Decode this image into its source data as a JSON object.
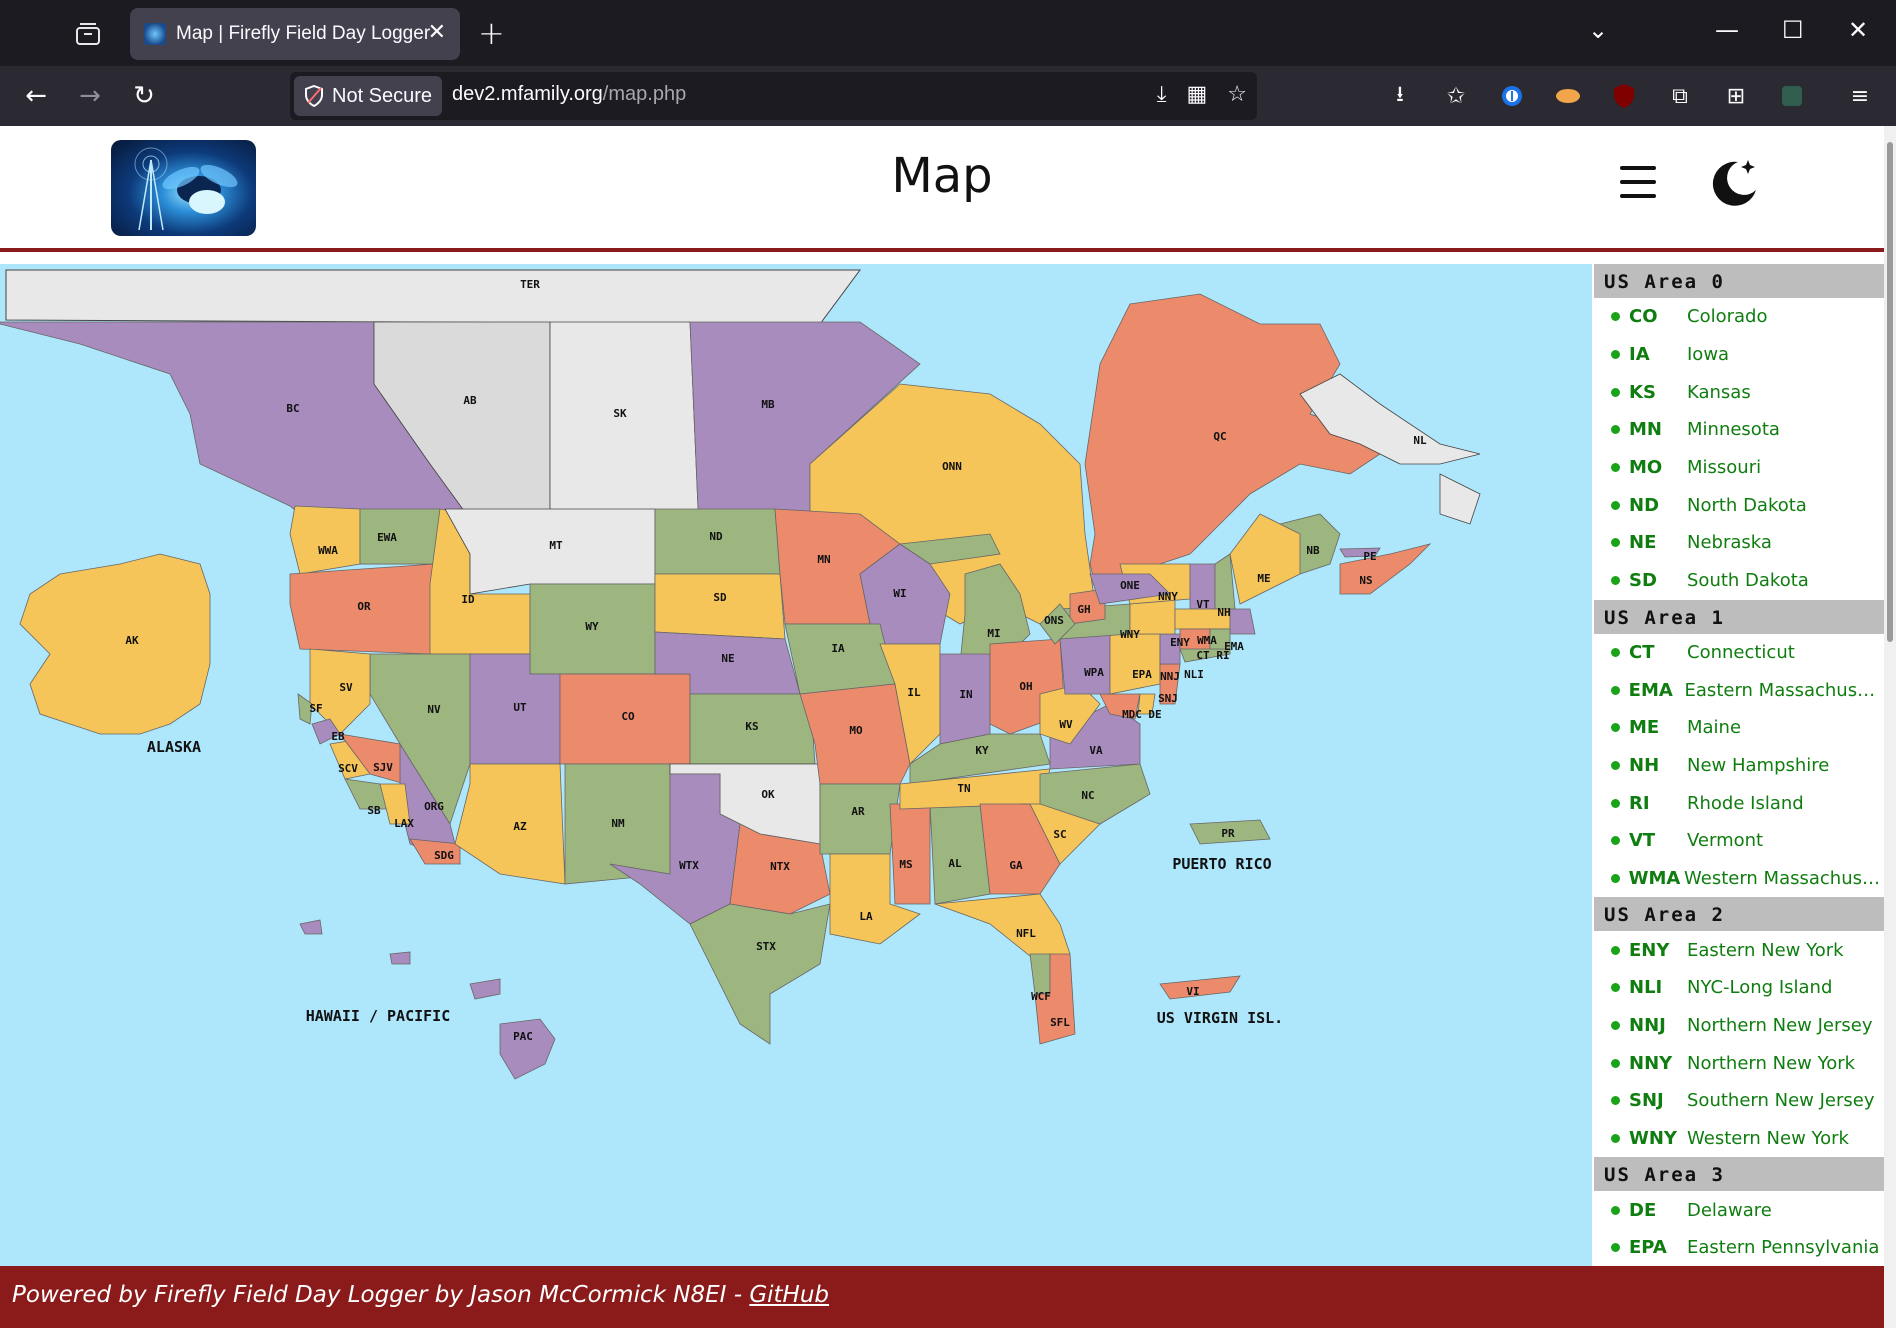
{
  "browser": {
    "tab_title": "Map | Firefly Field Day Logger",
    "security_label": "Not Secure",
    "url_domain": "dev2.mfamily.org",
    "url_path": "/map.php"
  },
  "page": {
    "title": "Map"
  },
  "map": {
    "labels": {
      "TER": "TER",
      "BC": "BC",
      "AB": "AB",
      "SK": "SK",
      "MB": "MB",
      "ONN": "ONN",
      "QC": "QC",
      "NL": "NL",
      "NB": "NB",
      "PE": "PE",
      "NS": "NS",
      "AK": "AK",
      "ALASKA": "ALASKA",
      "WWA": "WWA",
      "EWA": "EWA",
      "OR": "OR",
      "ID": "ID",
      "MT": "MT",
      "WY": "WY",
      "ND": "ND",
      "SD": "SD",
      "MN": "MN",
      "WI": "WI",
      "MI": "MI",
      "ONS": "ONS",
      "GH": "GH",
      "ONE": "ONE",
      "NNY": "NNY",
      "VT": "VT",
      "NH": "NH",
      "ME": "ME",
      "WNY": "WNY",
      "ENY": "ENY",
      "WMA": "WMA",
      "EMA": "EMA",
      "CT": "CT",
      "RI": "RI",
      "NNJ": "NNJ",
      "NLI": "NLI",
      "SNJ": "SNJ",
      "EPA": "EPA",
      "WPA": "WPA",
      "MDC": "MDC",
      "DE": "DE",
      "OH": "OH",
      "IN": "IN",
      "IL": "IL",
      "IA": "IA",
      "NE": "NE",
      "KS": "KS",
      "MO": "MO",
      "CO": "CO",
      "UT": "UT",
      "NV": "NV",
      "SV": "SV",
      "SF": "SF",
      "EB": "EB",
      "SCV": "SCV",
      "SJV": "SJV",
      "SB": "SB",
      "LAX": "LAX",
      "ORG": "ORG",
      "SDG": "SDG",
      "AZ": "AZ",
      "NM": "NM",
      "OK": "OK",
      "WTX": "WTX",
      "NTX": "NTX",
      "STX": "STX",
      "AR": "AR",
      "LA": "LA",
      "MS": "MS",
      "AL": "AL",
      "TN": "TN",
      "KY": "KY",
      "WV": "WV",
      "VA": "VA",
      "NC": "NC",
      "SC": "SC",
      "GA": "GA",
      "NFL": "NFL",
      "WCF": "WCF",
      "SFL": "SFL",
      "PR": "PR",
      "PUERTO_RICO": "PUERTO RICO",
      "VI": "VI",
      "US_VIRGIN": "US VIRGIN ISL.",
      "PAC": "PAC",
      "HAWAII": "HAWAII / PACIFIC"
    },
    "colors": {
      "orange": "#ec8a6c",
      "yellow": "#f5c55a",
      "green": "#9db57f",
      "purple": "#a98cbe",
      "gray": "#e2e2e2",
      "water": "#aee7fb"
    }
  },
  "sidebar": {
    "areas": [
      {
        "title": "US Area 0",
        "items": [
          {
            "code": "CO",
            "name": "Colorado"
          },
          {
            "code": "IA",
            "name": "Iowa"
          },
          {
            "code": "KS",
            "name": "Kansas"
          },
          {
            "code": "MN",
            "name": "Minnesota"
          },
          {
            "code": "MO",
            "name": "Missouri"
          },
          {
            "code": "ND",
            "name": "North Dakota"
          },
          {
            "code": "NE",
            "name": "Nebraska"
          },
          {
            "code": "SD",
            "name": "South Dakota"
          }
        ]
      },
      {
        "title": "US Area 1",
        "items": [
          {
            "code": "CT",
            "name": "Connecticut"
          },
          {
            "code": "EMA",
            "name": "Eastern Massachusetts"
          },
          {
            "code": "ME",
            "name": "Maine"
          },
          {
            "code": "NH",
            "name": "New Hampshire"
          },
          {
            "code": "RI",
            "name": "Rhode Island"
          },
          {
            "code": "VT",
            "name": "Vermont"
          },
          {
            "code": "WMA",
            "name": "Western Massachusetts"
          }
        ]
      },
      {
        "title": "US Area 2",
        "items": [
          {
            "code": "ENY",
            "name": "Eastern New York"
          },
          {
            "code": "NLI",
            "name": "NYC-Long Island"
          },
          {
            "code": "NNJ",
            "name": "Northern New Jersey"
          },
          {
            "code": "NNY",
            "name": "Northern New York"
          },
          {
            "code": "SNJ",
            "name": "Southern New Jersey"
          },
          {
            "code": "WNY",
            "name": "Western New York"
          }
        ]
      },
      {
        "title": "US Area 3",
        "items": [
          {
            "code": "DE",
            "name": "Delaware"
          },
          {
            "code": "EPA",
            "name": "Eastern Pennsylvania"
          }
        ]
      }
    ]
  },
  "footer": {
    "text": "Powered by Firefly Field Day Logger by Jason McCormick N8EI - ",
    "link": "GitHub"
  }
}
